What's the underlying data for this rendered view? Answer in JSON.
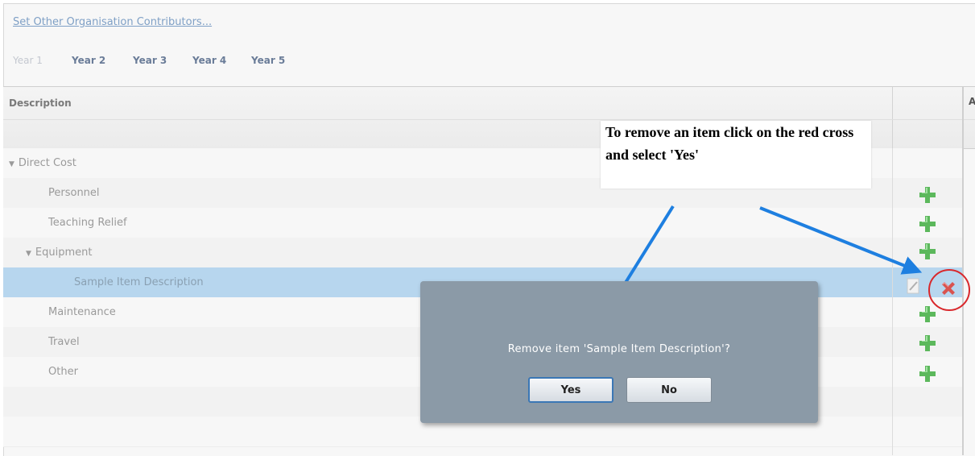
{
  "header": {
    "org_link": "Set Other Organisation Contributors...",
    "year_tabs": [
      "Year 1",
      "Year 2",
      "Year 3",
      "Year 4",
      "Year 5"
    ],
    "active_year": "Year 1"
  },
  "grid": {
    "column_description": "Description",
    "cut_off_column_initial": "A",
    "rows": [
      {
        "label": "Direct Cost",
        "level": 0,
        "expanded": true
      },
      {
        "label": "Personnel",
        "level": 1
      },
      {
        "label": "Teaching Relief",
        "level": 1
      },
      {
        "label": "Equipment",
        "level": 1,
        "expanded": true
      },
      {
        "label": "Sample Item Description",
        "level": 2,
        "selected": true
      },
      {
        "label": "Maintenance",
        "level": 1
      },
      {
        "label": "Travel",
        "level": 1
      },
      {
        "label": "Other",
        "level": 1
      }
    ],
    "row_icons": [
      "add-icon",
      "edit-icon",
      "delete-icon"
    ]
  },
  "callout": {
    "text": "To remove an item click on the red cross and select 'Yes'"
  },
  "dialog": {
    "message": "Remove item 'Sample Item Description'?",
    "yes_label": "Yes",
    "no_label": "No"
  },
  "colors": {
    "selected_row": "#b7d6ee",
    "dialog_bg": "#8b9aa7",
    "add_icon": "#5cb85c",
    "delete_icon": "#d9534f",
    "annotation_arrow": "#1e7fe0",
    "annotation_circle": "#d9272b"
  }
}
